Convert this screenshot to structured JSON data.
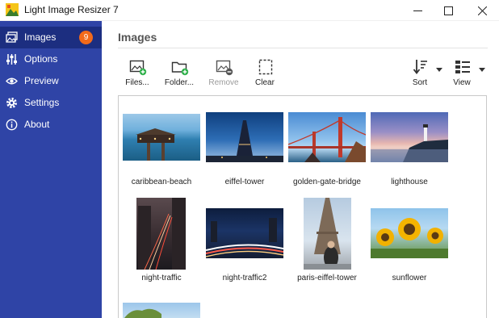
{
  "window": {
    "title": "Light Image Resizer 7",
    "icon": "app-logo-icon",
    "controls": [
      "minimize-icon",
      "maximize-icon",
      "close-icon"
    ]
  },
  "sidebar": {
    "items": [
      {
        "label": "Images",
        "icon": "images-icon",
        "badge": "9",
        "active": true
      },
      {
        "label": "Options",
        "icon": "sliders-icon"
      },
      {
        "label": "Preview",
        "icon": "eye-icon"
      },
      {
        "label": "Settings",
        "icon": "gear-icon"
      },
      {
        "label": "About",
        "icon": "info-icon"
      }
    ]
  },
  "main": {
    "title": "Images",
    "toolbar": {
      "files": "Files...",
      "folder": "Folder...",
      "remove": "Remove",
      "clear": "Clear",
      "sort": "Sort",
      "view": "View"
    },
    "images": [
      {
        "label": "caribbean-beach"
      },
      {
        "label": "eiffel-tower"
      },
      {
        "label": "golden-gate-bridge"
      },
      {
        "label": "lighthouse"
      },
      {
        "label": "night-traffic"
      },
      {
        "label": "night-traffic2"
      },
      {
        "label": "paris-eiffel-tower"
      },
      {
        "label": "sunflower"
      }
    ]
  },
  "colors": {
    "sidebar": "#2f44a6",
    "sidebar_active": "#1c2e80",
    "badge": "#f26a1b",
    "add_green": "#2eb04a"
  }
}
